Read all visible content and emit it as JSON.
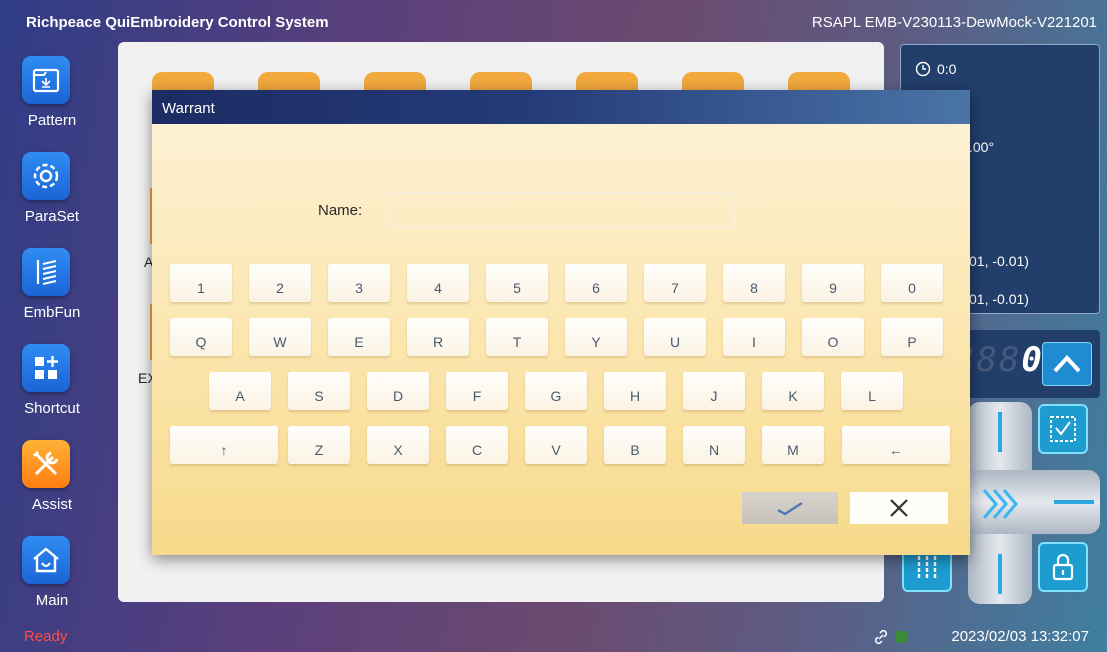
{
  "header": {
    "app_title": "Richpeace QuiEmbroidery Control System",
    "version": "RSAPL EMB-V230113-DewMock-V221201"
  },
  "sidebar": {
    "items": [
      {
        "label": "Pattern",
        "icon": "pattern-icon"
      },
      {
        "label": "ParaSet",
        "icon": "gear-icon"
      },
      {
        "label": "EmbFun",
        "icon": "embroidery-function-icon"
      },
      {
        "label": "Shortcut",
        "icon": "shortcut-grid-icon"
      },
      {
        "label": "Assist",
        "icon": "tools-icon"
      },
      {
        "label": "Main",
        "icon": "home-icon"
      }
    ]
  },
  "background_fragments": {
    "frag_a": "A",
    "frag_ex": "EX"
  },
  "right_panel": {
    "timer": "0:0",
    "angle_fragment": ".00°",
    "coord1_fragment": "01, -0.01)",
    "coord2_fragment": "01, -0.01)",
    "counter_ghost": "888",
    "counter_value": "0"
  },
  "dialog": {
    "title": "Warrant",
    "name_label": "Name:",
    "name_value": "",
    "keyboard": {
      "row1": [
        "1",
        "2",
        "3",
        "4",
        "5",
        "6",
        "7",
        "8",
        "9",
        "0"
      ],
      "row2": [
        "Q",
        "W",
        "E",
        "R",
        "T",
        "Y",
        "U",
        "I",
        "O",
        "P"
      ],
      "row3": [
        "A",
        "S",
        "D",
        "F",
        "G",
        "H",
        "J",
        "K",
        "L"
      ],
      "row4": [
        "↑",
        "Z",
        "X",
        "C",
        "V",
        "B",
        "N",
        "M",
        "←"
      ]
    },
    "confirm_icon": "check-icon",
    "cancel_icon": "close-icon"
  },
  "status": {
    "text": "Ready",
    "datetime": "2023/02/03 13:32:07",
    "text_color": "#ff4d4d"
  },
  "colors": {
    "accent_blue": "#1c64d6",
    "assist_orange": "#ff7d12",
    "dialog_header": "#1c2c63",
    "dialog_body": "#fbe4a8"
  }
}
